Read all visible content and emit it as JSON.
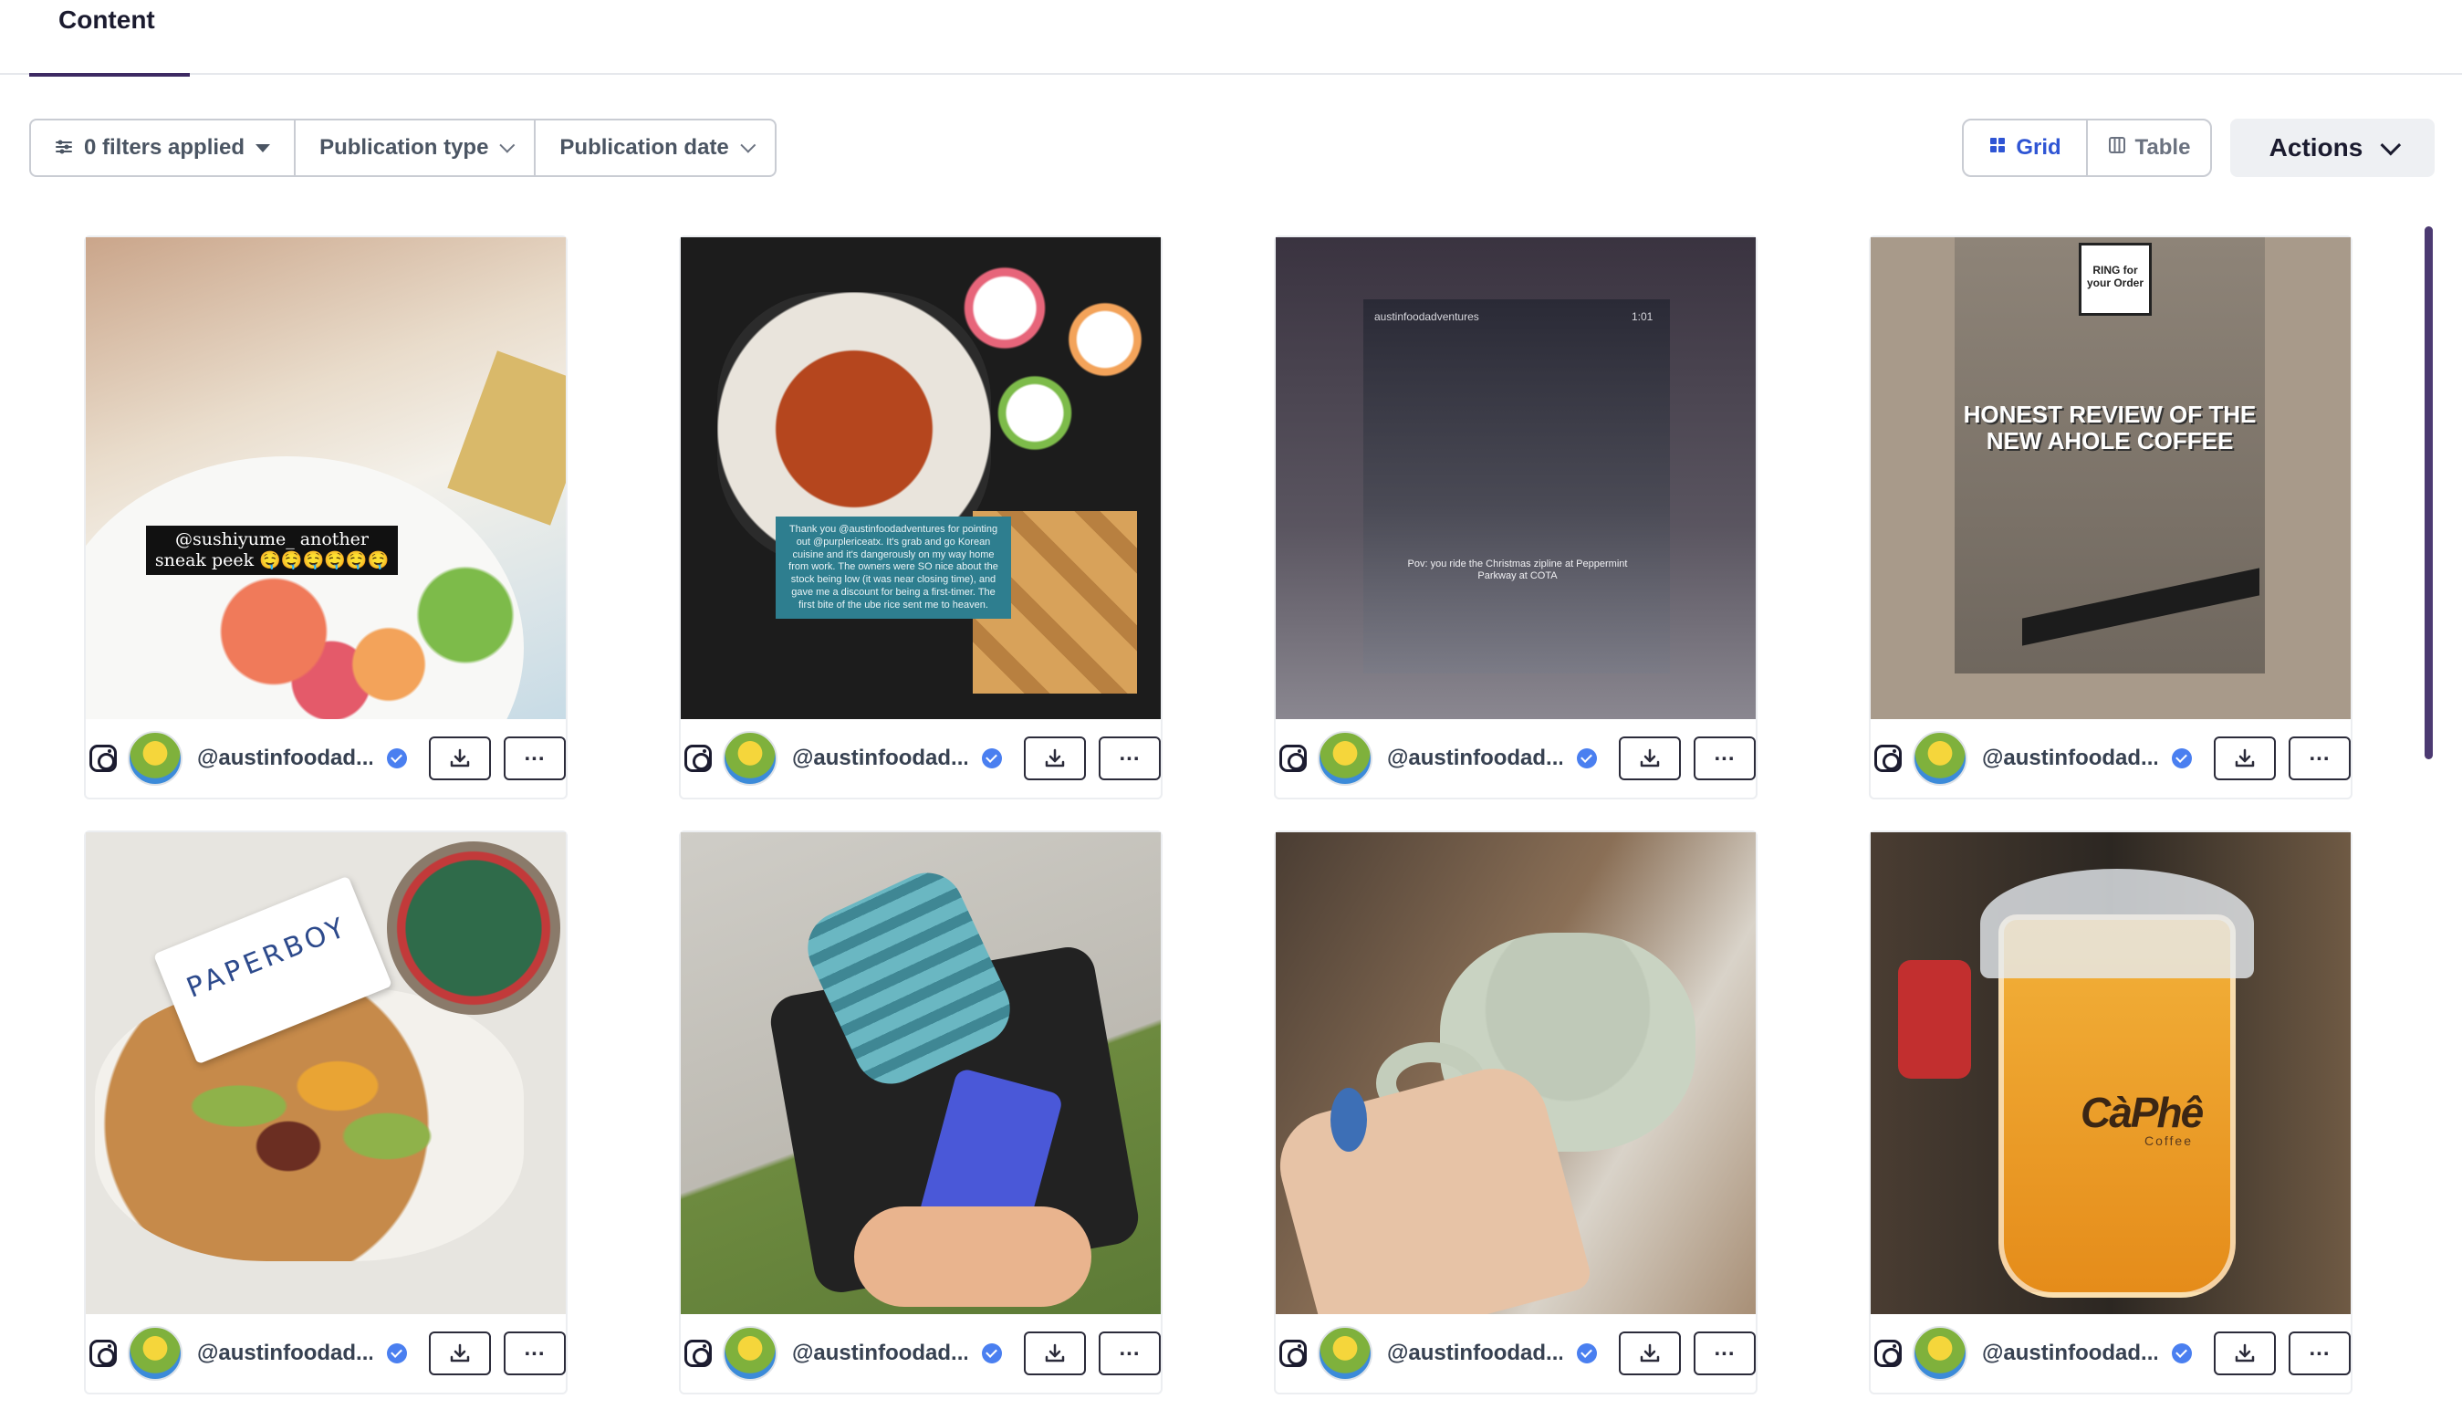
{
  "tabs": {
    "active_label": "Content"
  },
  "filters": {
    "applied": "0 filters applied",
    "publication_type": "Publication type",
    "publication_date": "Publication date"
  },
  "view": {
    "grid_label": "Grid",
    "table_label": "Table",
    "selected": "Grid"
  },
  "actions": {
    "label": "Actions"
  },
  "colors": {
    "accent": "#2f55d4",
    "tab_underline": "#3d2a63",
    "verified": "#4a7ff0"
  },
  "posts": [
    {
      "handle": "@austinfoodad...",
      "platform": "instagram",
      "overlay": "@sushiyume_ another sneak peek 🤤🤤🤤🤤🤤🤤"
    },
    {
      "handle": "@austinfoodad...",
      "platform": "instagram",
      "overlay": "Thank you @austinfoodadventures for pointing out @purplericeatx. It's grab and go Korean cuisine and it's dangerously on my way home from work. The owners were SO nice about the stock being low (it was near closing time), and gave me a discount for being a first-timer. The first bite of the ube rice sent me to heaven."
    },
    {
      "handle": "@austinfoodad...",
      "platform": "instagram",
      "story_user": "austinfoodadventures",
      "story_time": "1:01",
      "overlay": "Pov: you ride the Christmas zipline at Peppermint Parkway at COTA"
    },
    {
      "handle": "@austinfoodad...",
      "platform": "instagram",
      "overlay": "HONEST REVIEW OF THE NEW AHOLE COFFEE",
      "sign": "RING for your Order"
    },
    {
      "handle": "@austinfoodad...",
      "platform": "instagram",
      "overlay": "PAPERBOY"
    },
    {
      "handle": "@austinfoodad...",
      "platform": "instagram"
    },
    {
      "handle": "@austinfoodad...",
      "platform": "instagram"
    },
    {
      "handle": "@austinfoodad...",
      "platform": "instagram",
      "overlay": "CàPhê"
    }
  ],
  "icons": {
    "instagram": "instagram-icon",
    "verified": "verified-badge-icon",
    "download": "download-icon",
    "more": "more-horizontal-icon",
    "filter": "filter-lines-icon"
  }
}
